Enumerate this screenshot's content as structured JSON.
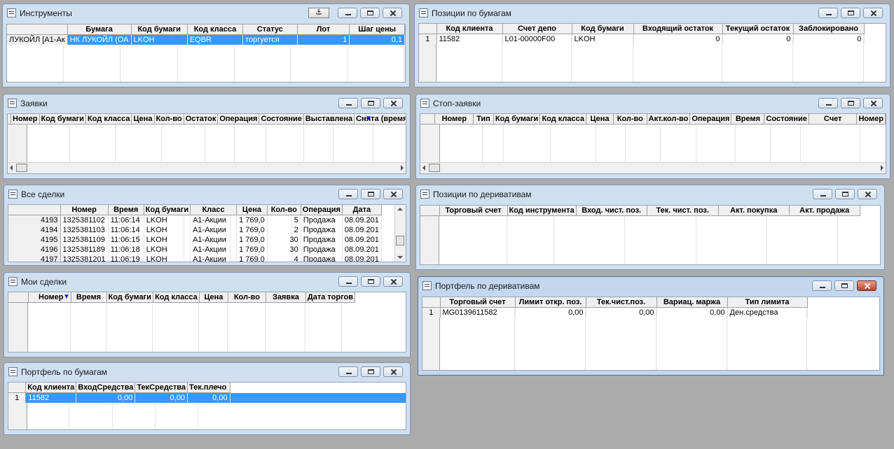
{
  "instruments": {
    "title": "Инструменты",
    "anchor_glyph": "⚓",
    "columns": [
      "",
      "Бумага",
      "Код бумаги",
      "Код класса",
      "Статус",
      "Лот",
      "Шаг цены"
    ],
    "rows": [
      [
        "ЛУКОЙЛ [А1-Ак",
        "НК ЛУКОЙЛ (ОА",
        "LKOH",
        "EQBR",
        "торгуется",
        "1",
        "0,1"
      ]
    ]
  },
  "positions_securities": {
    "title": "Позиции по бумагам",
    "columns": [
      "",
      "Код клиента",
      "Счет депо",
      "Код бумаги",
      "Входящий остаток",
      "Текущий остаток",
      "Заблокировано"
    ],
    "rows": [
      [
        "1",
        "11582",
        "L01-00000F00",
        "LKOH",
        "0",
        "0",
        "0"
      ]
    ]
  },
  "orders": {
    "title": "Заявки",
    "columns": [
      "",
      "Номер",
      "Код бумаги",
      "Код класса",
      "Цена",
      "Кол-во",
      "Остаток",
      "Операция",
      "Состояние",
      "Выставлена",
      "Снята (время)"
    ]
  },
  "stop_orders": {
    "title": "Стоп-заявки",
    "columns": [
      "",
      "Номер",
      "Тип",
      "Код бумаги",
      "Код класса",
      "Цена",
      "Кол-во",
      "Акт.кол-во",
      "Операция",
      "Время",
      "Состояние",
      "Счет",
      "Номер"
    ]
  },
  "all_trades": {
    "title": "Все сделки",
    "columns": [
      "",
      "Номер",
      "Время",
      "Код бумаги",
      "Класс",
      "Цена",
      "Кол-во",
      "Операция",
      "Дата"
    ],
    "rows": [
      [
        "4193",
        "1325381102",
        "11:06:14",
        "LKOH",
        "А1-Акции",
        "1 769,0",
        "5",
        "Продажа",
        "08.09.201"
      ],
      [
        "4194",
        "1325381103",
        "11:06:14",
        "LKOH",
        "А1-Акции",
        "1 769,0",
        "2",
        "Продажа",
        "08.09.201"
      ],
      [
        "4195",
        "1325381109",
        "11:06:15",
        "LKOH",
        "А1-Акции",
        "1 769,0",
        "30",
        "Продажа",
        "08.09.201"
      ],
      [
        "4196",
        "1325381189",
        "11:06:18",
        "LKOH",
        "А1-Акции",
        "1 769,0",
        "30",
        "Продажа",
        "08.09.201"
      ],
      [
        "4197",
        "1325381201",
        "11:06:19",
        "LKOH",
        "А1-Акции",
        "1 769,0",
        "4",
        "Продажа",
        "08.09.201"
      ]
    ]
  },
  "positions_derivatives": {
    "title": "Позиции по деривативам",
    "columns": [
      "",
      "Торговый счет",
      "Код инструмента",
      "Вход. чист. поз.",
      "Тек. чист. поз.",
      "Акт. покупка",
      "Акт. продажа"
    ]
  },
  "my_trades": {
    "title": "Мои сделки",
    "columns": [
      "",
      "Номер",
      "Время",
      "Код бумаги",
      "Код класса",
      "Цена",
      "Кол-во",
      "Заявка",
      "Дата торгов"
    ]
  },
  "portfolio_derivatives": {
    "title": "Портфель по деривативам",
    "columns": [
      "",
      "Торговый счет",
      "Лимит откр. поз.",
      "Тек.чист.поз.",
      "Вариац. маржа",
      "Тип лимита"
    ],
    "rows": [
      [
        "1",
        "MG0139611582",
        "0,00",
        "0,00",
        "0,00",
        "Ден.средства"
      ]
    ]
  },
  "portfolio_securities": {
    "title": "Портфель по бумагам",
    "columns": [
      "",
      "Код клиента",
      "ВходСредства",
      "ТекСредства",
      "Тек.плечо"
    ],
    "rows": [
      [
        "1",
        "11582",
        "0,00",
        "0,00",
        "0,00"
      ]
    ]
  }
}
